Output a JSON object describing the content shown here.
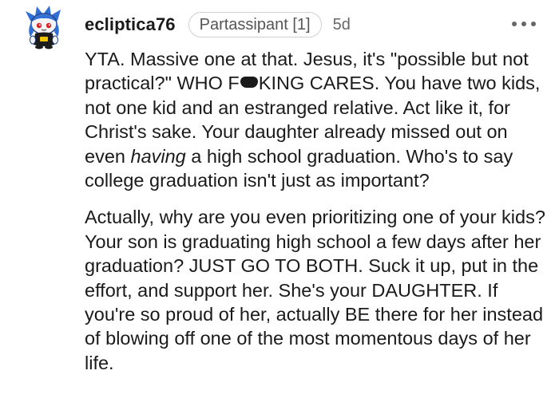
{
  "comment": {
    "author": "ecliptica76",
    "flair": "Partassipant [1]",
    "age": "5d",
    "more_icon": "ellipsis-icon",
    "avatar_icon": "snoo-avatar-icon",
    "censor_icon": "censor-blob-icon",
    "colors": {
      "text": "#1a1a1b",
      "muted": "#666666",
      "flair_border": "#d0d0d0",
      "avatar_hair": "#2f6fd6"
    },
    "paragraph_1": {
      "part_1": "YTA. Massive one at that. Jesus, it's \"possible but not practical?\" WHO F",
      "part_2": "KING CARES. You have two kids, not one kid and an estranged relative. Act like it, for Christ's sake. Your daughter already missed out on even ",
      "emphasis": "having",
      "part_3": " a high school graduation. Who's to say college graduation isn't just as important?"
    },
    "paragraph_2": "Actually, why are you even prioritizing one of your kids? Your son is graduating high school a few days after her graduation? JUST GO TO BOTH. Suck it up, put in the effort, and support her. She's your DAUGHTER. If you're so proud of her, actually BE there for her instead of blowing off one of the most momentous days of her life."
  }
}
